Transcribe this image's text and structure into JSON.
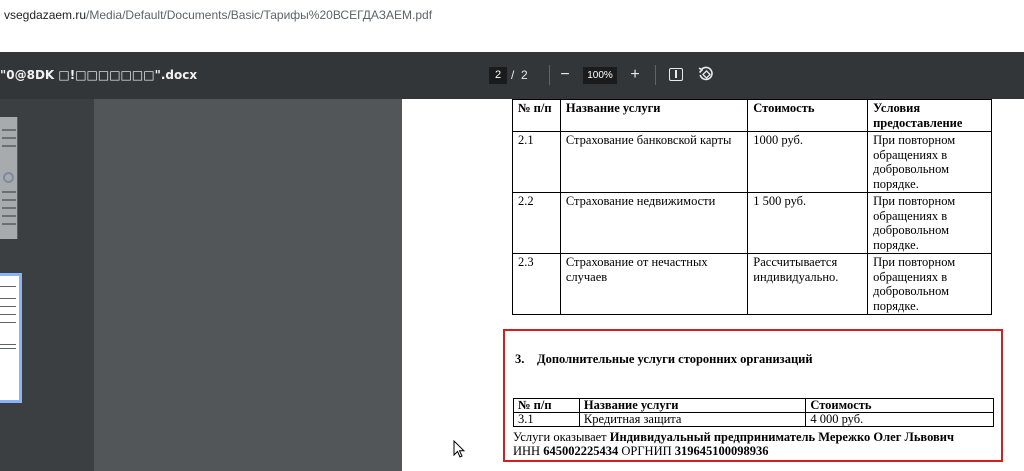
{
  "browser": {
    "url_host": "vsegdazaem.ru",
    "url_path": "/Media/Default/Documents/Basic/Тарифы%20ВСЕГДАЗАЕМ.pdf"
  },
  "toolbar": {
    "doc_title": "\"0@8DK □!□□□□□□□\".docx",
    "page_current": "2",
    "page_sep": "/",
    "page_total": "2",
    "zoom_out": "−",
    "zoom_value": "100%",
    "zoom_in": "+",
    "icons": [
      "fit-page-icon",
      "rotate-icon"
    ]
  },
  "table1": {
    "headers": [
      "№ п/п",
      "Название услуги",
      "Стоимость",
      "Условия предоставление"
    ],
    "rows": [
      [
        "2.1",
        "Страхование банковской карты",
        "1000 руб.",
        "При повторном обращениях в добровольном порядке."
      ],
      [
        "2.2",
        "Страхование недвижимости",
        "1 500 руб.",
        "При повторном обращениях в добровольном порядке."
      ],
      [
        "2.3",
        "Страхование от нечастных случаев",
        "Рассчитывается индивидуально.",
        "При повторном обращениях в добровольном порядке."
      ]
    ]
  },
  "section3": {
    "number": "3.",
    "title": "Дополнительные услуги сторонних организаций",
    "headers": [
      "№ п/п",
      "Название услуги",
      "Стоимость"
    ],
    "rows": [
      [
        "3.1",
        "Кредитная защита",
        "4 000 руб."
      ]
    ],
    "provider_prefix": "Услуги оказывает",
    "provider_name": "Индивидуальный предприниматель Мережко Олег Львович",
    "inn_label": "ИНН",
    "inn_value": "645002225434",
    "ogrnip_label": "ОРГНИП",
    "ogrnip_value": "319645100098936"
  },
  "colors": {
    "toolbar_bg": "#323639",
    "viewer_bg": "#525659",
    "highlight_border": "#d21f1f",
    "thumb_selected": "#8ab4f8"
  }
}
